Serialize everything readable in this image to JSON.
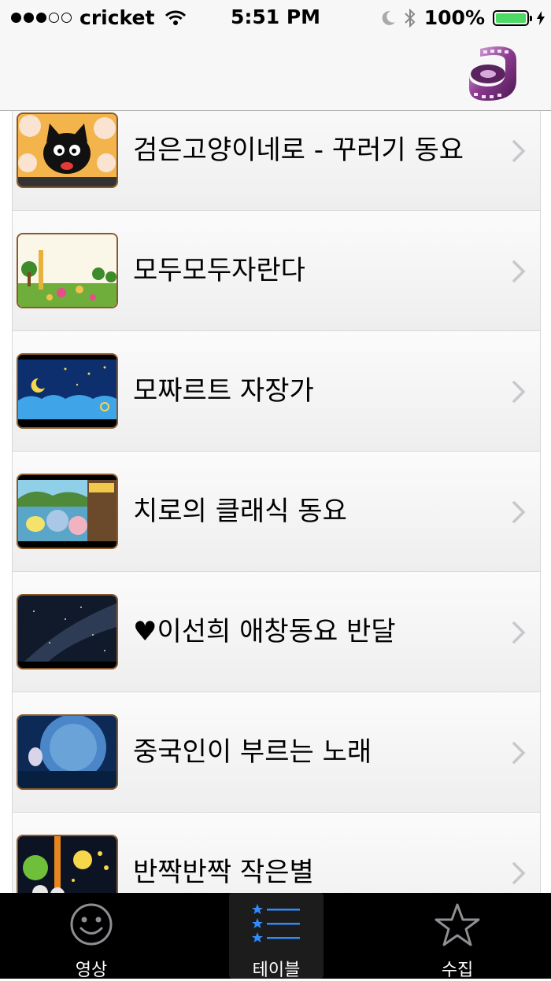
{
  "status": {
    "carrier": "cricket",
    "time": "5:51 PM",
    "battery": "100%",
    "battery_level": 1.0
  },
  "nav": {
    "logo_icon": "film-reel-icon"
  },
  "list": {
    "items": [
      {
        "title": "검은고양이네로 - 꾸러기 동요",
        "thumb": "black-cat-thumbnail"
      },
      {
        "title": "모두모두자란다",
        "thumb": "garden-thumbnail"
      },
      {
        "title": "모짜르트 자장가",
        "thumb": "night-sky-thumbnail"
      },
      {
        "title": "치로의 클래식 동요",
        "thumb": "chiro-thumbnail"
      },
      {
        "title": "♥이선희 애창동요 반달",
        "thumb": "milky-way-thumbnail"
      },
      {
        "title": "중국인이 부르는 노래",
        "thumb": "moon-rabbit-thumbnail"
      },
      {
        "title": "반짝반짝 작은별",
        "thumb": "twinkle-star-thumbnail"
      }
    ]
  },
  "tabs": [
    {
      "label": "영상",
      "icon": "smiley-icon",
      "selected": false
    },
    {
      "label": "테이블",
      "icon": "list-star-icon",
      "selected": true
    },
    {
      "label": "수집",
      "icon": "star-icon",
      "selected": false
    }
  ],
  "colors": {
    "accent": "#2f8cff",
    "thumb_border": "#8b5a2b",
    "tab_bar": "#000000",
    "battery": "#4cd964"
  }
}
